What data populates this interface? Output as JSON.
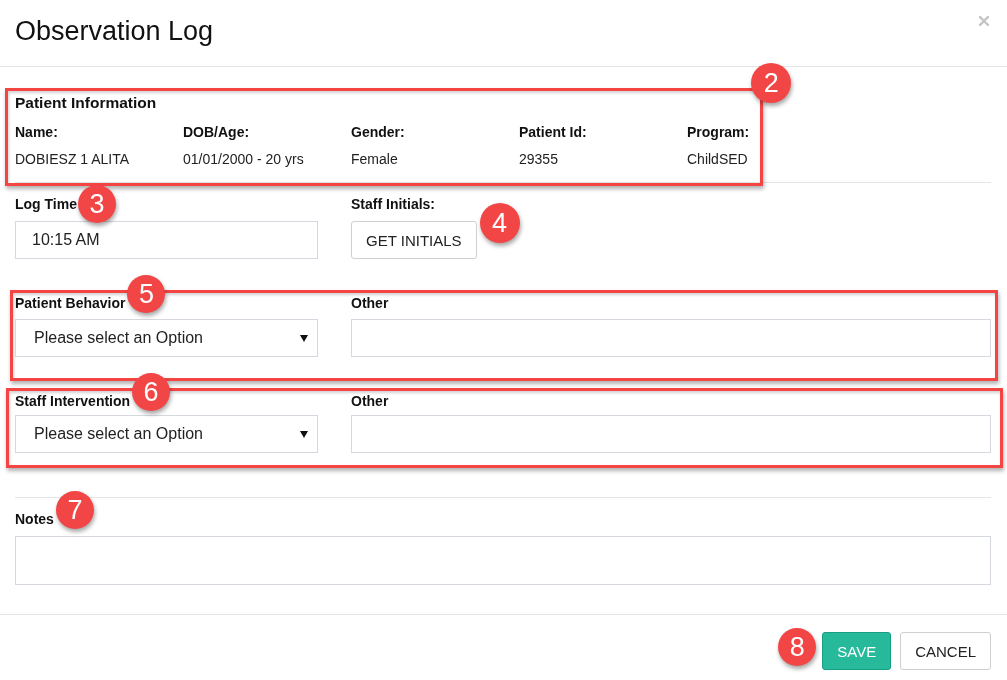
{
  "title": "Observation Log",
  "patient_information": {
    "heading": "Patient Information",
    "highlighted": true,
    "callout": "2",
    "fields": [
      {
        "label": "Name:",
        "value": "DOBIESZ 1 ALITA"
      },
      {
        "label": "DOB/Age:",
        "value": "01/01/2000 - 20 yrs"
      },
      {
        "label": "Gender:",
        "value": "Female"
      },
      {
        "label": "Patient Id:",
        "value": "29355"
      },
      {
        "label": "Program:",
        "value": "ChildSED"
      }
    ]
  },
  "log_time": {
    "label": "Log Time",
    "callout": "3",
    "value": "10:15 AM"
  },
  "staff_initials": {
    "label": "Staff Initials:",
    "button": "GET INITIALS",
    "callout": "4"
  },
  "selection_rows": [
    {
      "label": "Patient Behavior",
      "callout": "5",
      "highlighted": true,
      "selected_option": "Please select an Option",
      "other_label": "Other"
    },
    {
      "label": "Staff Intervention",
      "callout": "6",
      "highlighted": true,
      "selected_option": "Please select an Option",
      "other_label": "Other"
    }
  ],
  "notes": {
    "label": "Notes",
    "callout": "7"
  },
  "footer_buttons": [
    {
      "label": "SAVE",
      "kind": "primary",
      "callout": "8"
    },
    {
      "label": "CANCEL",
      "kind": "default"
    }
  ]
}
